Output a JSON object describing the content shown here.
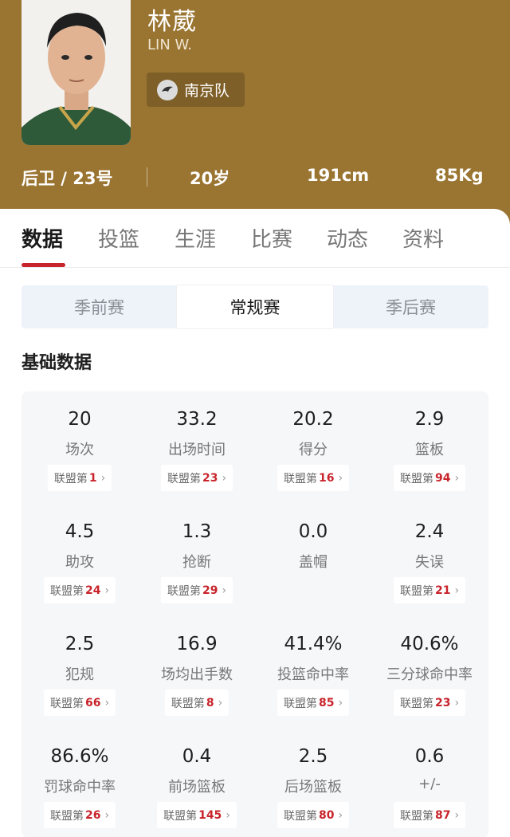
{
  "player": {
    "name_cn": "林葳",
    "name_en": "LIN W.",
    "team": "南京队",
    "position_number": "后卫 / 23号",
    "age": "20岁",
    "height": "191cm",
    "weight": "85Kg"
  },
  "tabs": [
    "数据",
    "投篮",
    "生涯",
    "比赛",
    "动态",
    "资料"
  ],
  "active_tab": "数据",
  "season_types": [
    "季前赛",
    "常规赛",
    "季后赛"
  ],
  "active_season_type": "常规赛",
  "section_title": "基础数据",
  "rank_prefix": "联盟第",
  "colors": {
    "header_bg": "#9a7431",
    "accent": "#c8242b",
    "panel_bg": "#f6f7f9"
  },
  "stats": [
    {
      "value": "20",
      "label": "场次",
      "rank": "1"
    },
    {
      "value": "33.2",
      "label": "出场时间",
      "rank": "23"
    },
    {
      "value": "20.2",
      "label": "得分",
      "rank": "16"
    },
    {
      "value": "2.9",
      "label": "篮板",
      "rank": "94"
    },
    {
      "value": "4.5",
      "label": "助攻",
      "rank": "24"
    },
    {
      "value": "1.3",
      "label": "抢断",
      "rank": "29"
    },
    {
      "value": "0.0",
      "label": "盖帽",
      "rank": ""
    },
    {
      "value": "2.4",
      "label": "失误",
      "rank": "21"
    },
    {
      "value": "2.5",
      "label": "犯规",
      "rank": "66"
    },
    {
      "value": "16.9",
      "label": "场均出手数",
      "rank": "8"
    },
    {
      "value": "41.4%",
      "label": "投篮命中率",
      "rank": "85"
    },
    {
      "value": "40.6%",
      "label": "三分球命中率",
      "rank": "23"
    },
    {
      "value": "86.6%",
      "label": "罚球命中率",
      "rank": "26"
    },
    {
      "value": "0.4",
      "label": "前场篮板",
      "rank": "145"
    },
    {
      "value": "2.5",
      "label": "后场篮板",
      "rank": "80"
    },
    {
      "value": "0.6",
      "label": "+/-",
      "rank": "87"
    }
  ]
}
